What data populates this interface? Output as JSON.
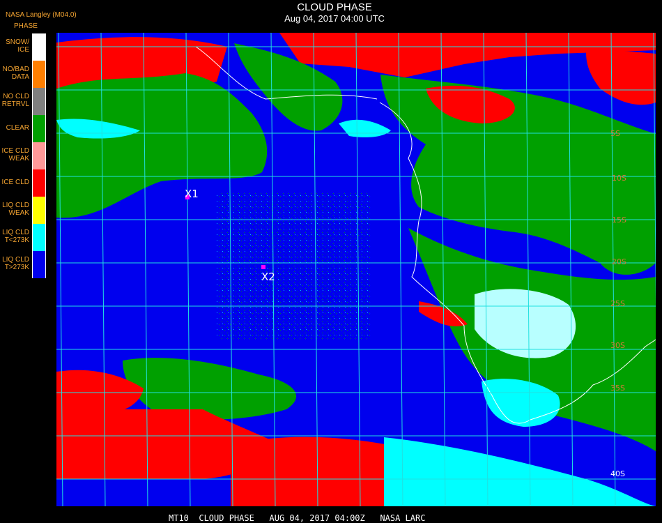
{
  "header": {
    "title": "CLOUD PHASE",
    "subtitle": "Aug 04, 2017 04:00 UTC",
    "provider": "NASA Langley (M04.0)",
    "legend_title": "PHASE"
  },
  "legend": [
    {
      "label_lines": [
        "SNOW/",
        "ICE"
      ],
      "color": "#ffffff"
    },
    {
      "label_lines": [
        "NO/BAD",
        "DATA"
      ],
      "color": "#ff7f00"
    },
    {
      "label_lines": [
        "NO CLD",
        "RETRVL"
      ],
      "color": "#808080"
    },
    {
      "label_lines": [
        "CLEAR"
      ],
      "color": "#00a000"
    },
    {
      "label_lines": [
        "ICE CLD",
        "WEAK"
      ],
      "color": "#ff9999"
    },
    {
      "label_lines": [
        "ICE CLD"
      ],
      "color": "#ff0000"
    },
    {
      "label_lines": [
        "LIQ CLD",
        "WEAK"
      ],
      "color": "#ffff00"
    },
    {
      "label_lines": [
        "LIQ CLD",
        "T<273K"
      ],
      "color": "#00ffff"
    },
    {
      "label_lines": [
        "LIQ CLD",
        "T>273K"
      ],
      "color": "#0000ee"
    }
  ],
  "markers": [
    {
      "label": "X1",
      "color": "#ff00ff"
    },
    {
      "label": "X2",
      "color": "#ff00ff"
    }
  ],
  "latitude_labels": [
    "5S",
    "10S",
    "15S",
    "20S",
    "25S",
    "30S",
    "35S",
    "40S"
  ],
  "footer": "MT10  CLOUD PHASE   AUG 04, 2017 04:00Z   NASA LARC",
  "colors": {
    "grid": "#20e0e0",
    "coast": "#ffffff",
    "label_orange": "#f4a431"
  }
}
